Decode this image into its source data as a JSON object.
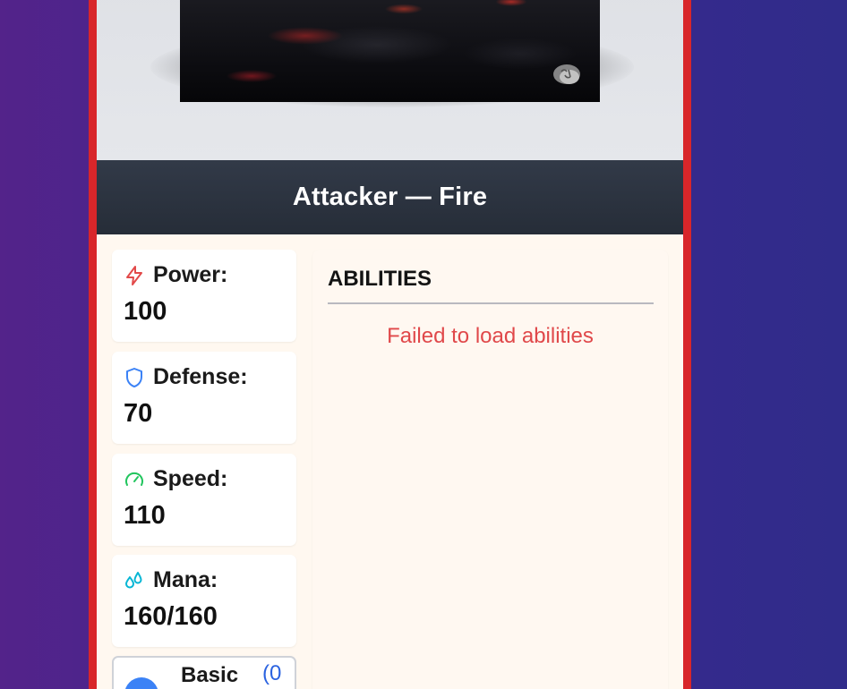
{
  "card": {
    "title": "Attacker — Fire",
    "colors": {
      "border": "#d8262a",
      "title_bar": "#2b313d",
      "panel": "#fff8f0"
    }
  },
  "stats": [
    {
      "label": "Power:",
      "value": "100",
      "icon": "lightning-icon",
      "color": "#e24a4a"
    },
    {
      "label": "Defense:",
      "value": "70",
      "icon": "shield-icon",
      "color": "#3b82f6"
    },
    {
      "label": "Speed:",
      "value": "110",
      "icon": "speedometer-icon",
      "color": "#22c55e"
    },
    {
      "label": "Mana:",
      "value": "160/160",
      "icon": "droplets-icon",
      "color": "#06b6d4"
    }
  ],
  "abilities": {
    "title": "ABILITIES",
    "error": "Failed to load abilities",
    "error_color": "#e0484a"
  },
  "basic": {
    "label": "Basic",
    "count": "(0",
    "dot_color": "#3b82f6"
  }
}
